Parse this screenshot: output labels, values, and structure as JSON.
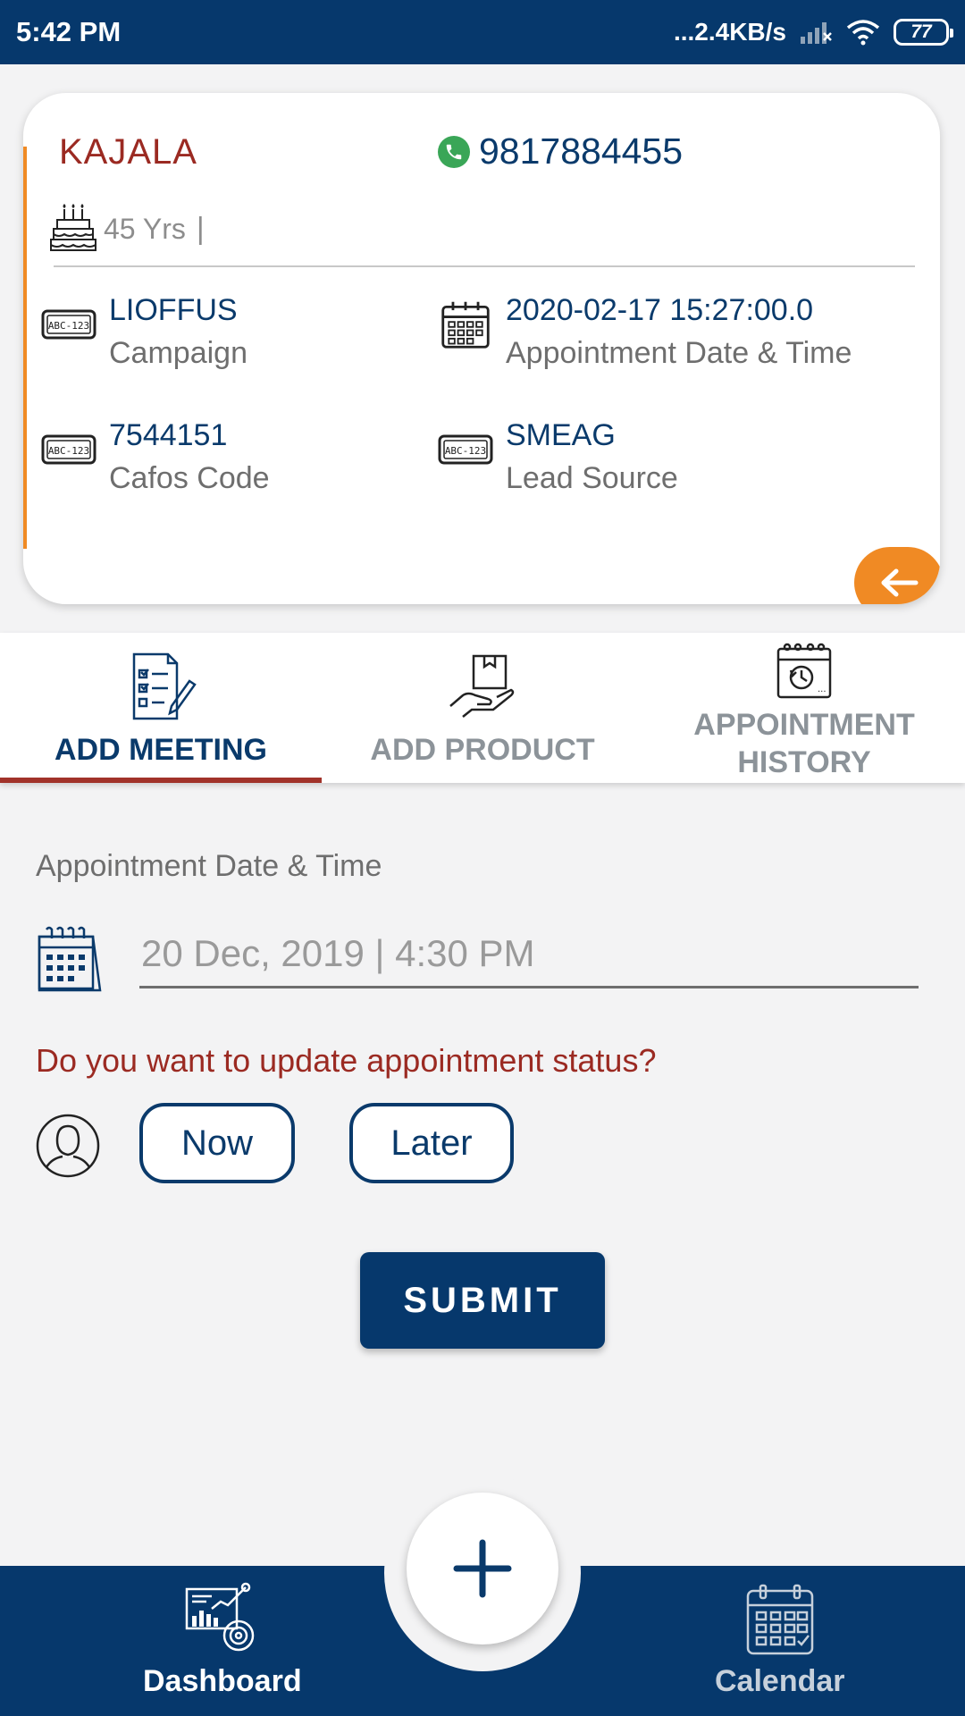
{
  "status_bar": {
    "time": "5:42 PM",
    "network_speed": "...2.4KB/s",
    "battery": "77"
  },
  "lead": {
    "name": "KAJALA",
    "phone": "9817884455",
    "age": "45 Yrs",
    "age_separator": "|",
    "campaign": {
      "value": "LIOFFUS",
      "label": "Campaign"
    },
    "appointment": {
      "value": "2020-02-17 15:27:00.0",
      "label": "Appointment Date & Time"
    },
    "cafos_code": {
      "value": "7544151",
      "label": "Cafos Code"
    },
    "lead_source": {
      "value": "SMEAG",
      "label": "Lead Source"
    }
  },
  "tabs": [
    {
      "label": "ADD MEETING",
      "active": true
    },
    {
      "label": "ADD PRODUCT",
      "active": false
    },
    {
      "label": "APPOINTMENT HISTORY",
      "active": false
    }
  ],
  "form": {
    "date_label": "Appointment Date & Time",
    "date_value": "20 Dec, 2019 | 4:30 PM",
    "question": "Do you want to update appointment status?",
    "option_now": "Now",
    "option_later": "Later",
    "submit": "SUBMIT"
  },
  "bottom_nav": {
    "dashboard": "Dashboard",
    "calendar": "Calendar"
  },
  "colors": {
    "primary": "#06386c",
    "accent": "#f08a24",
    "alert_red": "#9b2a22",
    "whatsapp_green": "#3aa657"
  },
  "icons": {
    "phone": "whatsapp-phone-icon",
    "age": "birthday-cake-icon",
    "campaign": "license-plate-icon",
    "appointment": "calendar-icon",
    "back": "arrow-left-icon",
    "add_meeting": "checklist-pen-icon",
    "add_product": "hand-box-icon",
    "history": "calendar-clock-icon",
    "status": "user-outline-icon",
    "fab": "plus-icon",
    "dashboard": "dashboard-chart-icon",
    "calendar_nav": "calendar-check-icon"
  }
}
